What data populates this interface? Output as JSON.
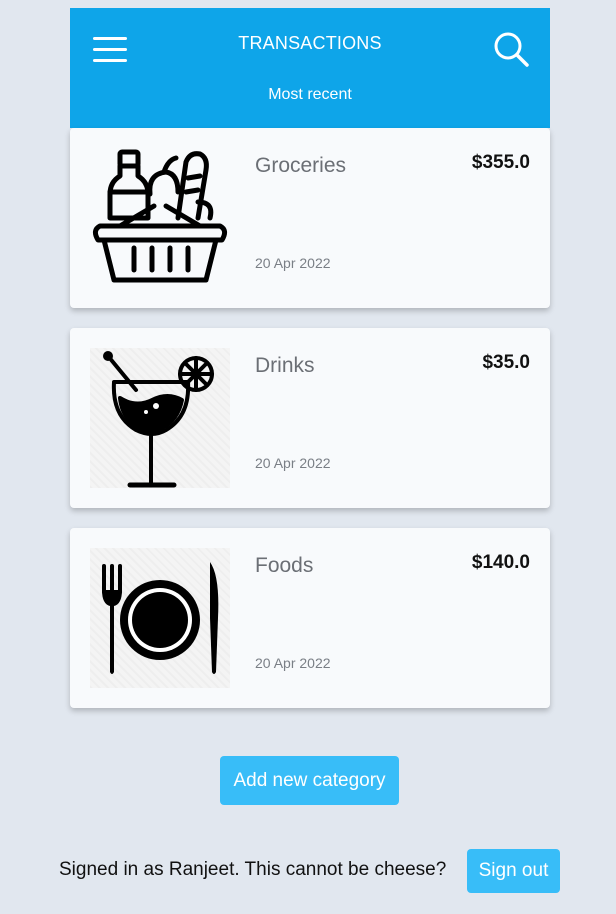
{
  "header": {
    "title": "TRANSACTIONS",
    "subtitle": "Most recent",
    "menu_icon": "hamburger-menu-icon",
    "search_icon": "search-icon",
    "background": "#0ea5e9"
  },
  "transactions": [
    {
      "name": "Groceries",
      "amount": "$355.0",
      "date": "20 Apr 2022",
      "icon": "grocery-basket-icon"
    },
    {
      "name": "Drinks",
      "amount": "$35.0",
      "date": "20 Apr 2022",
      "icon": "cocktail-glass-icon"
    },
    {
      "name": "Foods",
      "amount": "$140.0",
      "date": "20 Apr 2022",
      "icon": "plate-fork-knife-icon"
    }
  ],
  "actions": {
    "add_category_label": "Add new category"
  },
  "footer": {
    "signed_in_text": "Signed in as Ranjeet. This cannot be cheese?",
    "sign_out_label": "Sign out"
  },
  "colors": {
    "accent": "#0ea5e9",
    "button": "#38bdf8",
    "page_background": "#e1e7ef",
    "card_background": "#f8fafc"
  }
}
